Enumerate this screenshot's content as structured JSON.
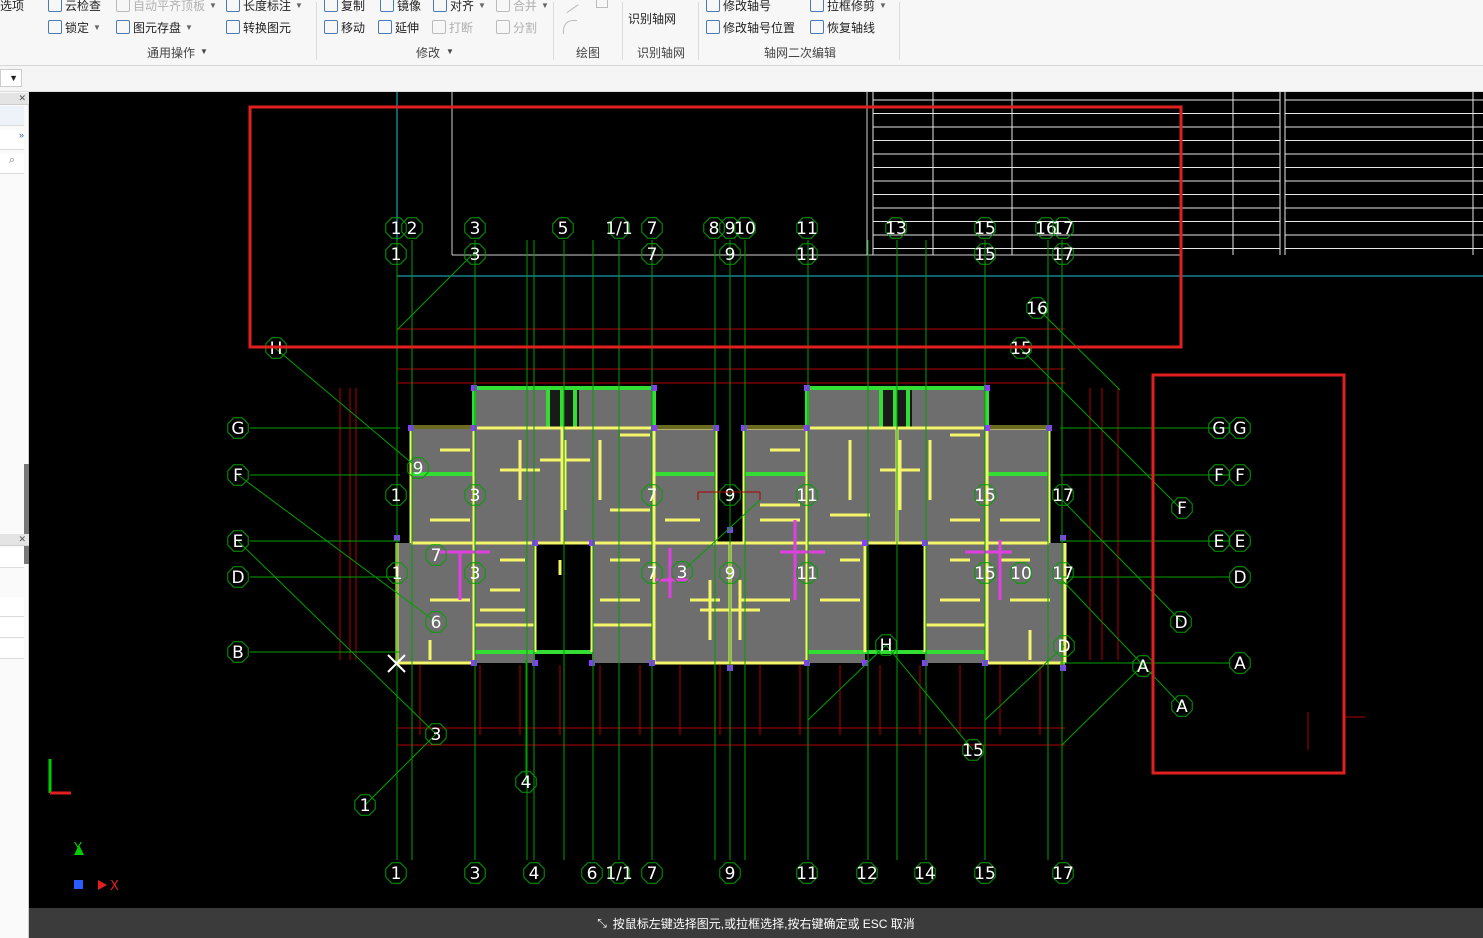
{
  "ribbon": {
    "row1": [
      {
        "name": "options-tab-partial",
        "label": "选项",
        "disabled": false
      },
      {
        "name": "cloud-check-button",
        "label": "云检查",
        "disabled": false
      },
      {
        "name": "auto-flat-board-button",
        "label": "自动平齐顶板",
        "disabled": true
      },
      {
        "name": "length-annotation-button",
        "label": "长度标注",
        "disabled": false
      },
      {
        "name": "copy-button",
        "label": "复制",
        "disabled": false
      },
      {
        "name": "mirror-button",
        "label": "镜像",
        "disabled": false
      },
      {
        "name": "align-button",
        "label": "对齐",
        "disabled": false
      },
      {
        "name": "merge-button",
        "label": "合并",
        "disabled": true
      },
      {
        "name": "modify-axis-number-button",
        "label": "修改轴号",
        "disabled": false
      },
      {
        "name": "box-trim-button",
        "label": "拉框修剪",
        "disabled": false
      }
    ],
    "row2": [
      {
        "name": "lock-button",
        "label": "锁定",
        "disabled": false
      },
      {
        "name": "element-save-button",
        "label": "图元存盘",
        "disabled": false
      },
      {
        "name": "convert-element-button",
        "label": "转换图元",
        "disabled": false
      },
      {
        "name": "move-button",
        "label": "移动",
        "disabled": false
      },
      {
        "name": "extend-button",
        "label": "延伸",
        "disabled": false
      },
      {
        "name": "break-button",
        "label": "打断",
        "disabled": true
      },
      {
        "name": "split-button",
        "label": "分割",
        "disabled": true
      },
      {
        "name": "modify-axis-position-button",
        "label": "修改轴号位置",
        "disabled": false
      },
      {
        "name": "restore-axis-button",
        "label": "恢复轴线",
        "disabled": false
      }
    ],
    "identify_grid_label": "识别轴网",
    "groups": {
      "general": "通用操作",
      "modify": "修改",
      "draw": "绘图",
      "identify": "识别轴网",
      "secondary_edit": "轴网二次编辑"
    }
  },
  "status": {
    "message": "按鼠标左键选择图元,或拉框选择,按右键确定或 ESC 取消"
  },
  "coords": {
    "x_label": "X",
    "y_label": "Y"
  },
  "colors": {
    "canvas_bg": "#000000",
    "axis_green": "#00a000",
    "label_white": "#ffffff",
    "wall_yellow": "#f5f56a",
    "floor_gray": "#6e6e6e",
    "beam_green": "#33dd33",
    "dim_red": "#b00000",
    "highlight_red": "#e02020",
    "magenta": "#e040e0",
    "cyan": "#20c0d0"
  },
  "cad": {
    "axis_labels": [
      {
        "t": "1"
      },
      {
        "t": "2"
      },
      {
        "t": "3"
      },
      {
        "t": "5"
      },
      {
        "t": "1/1"
      },
      {
        "t": "7"
      },
      {
        "t": "8"
      },
      {
        "t": "9"
      },
      {
        "t": "10"
      },
      {
        "t": "11"
      },
      {
        "t": "13"
      },
      {
        "t": "15"
      },
      {
        "t": "16"
      },
      {
        "t": "17"
      },
      {
        "t": "1"
      },
      {
        "t": "3"
      },
      {
        "t": "7"
      },
      {
        "t": "9"
      },
      {
        "t": "11"
      },
      {
        "t": "15"
      },
      {
        "t": "17"
      },
      {
        "t": "16"
      },
      {
        "t": "15"
      },
      {
        "t": "H"
      },
      {
        "t": "G"
      },
      {
        "t": "F"
      },
      {
        "t": "E"
      },
      {
        "t": "D"
      },
      {
        "t": "B"
      },
      {
        "t": "G"
      },
      {
        "t": "G"
      },
      {
        "t": "F"
      },
      {
        "t": "F"
      },
      {
        "t": "F"
      },
      {
        "t": "E"
      },
      {
        "t": "E"
      },
      {
        "t": "D"
      },
      {
        "t": "D"
      },
      {
        "t": "A"
      },
      {
        "t": "A"
      },
      {
        "t": "A"
      },
      {
        "t": "9"
      },
      {
        "t": "1"
      },
      {
        "t": "3"
      },
      {
        "t": "7"
      },
      {
        "t": "9"
      },
      {
        "t": "11"
      },
      {
        "t": "15"
      },
      {
        "t": "17"
      },
      {
        "t": "7"
      },
      {
        "t": "1"
      },
      {
        "t": "3"
      },
      {
        "t": "7"
      },
      {
        "t": "3"
      },
      {
        "t": "9"
      },
      {
        "t": "11"
      },
      {
        "t": "15"
      },
      {
        "t": "10"
      },
      {
        "t": "17"
      },
      {
        "t": "6"
      },
      {
        "t": "H"
      },
      {
        "t": "D"
      },
      {
        "t": "3"
      },
      {
        "t": "15"
      },
      {
        "t": "4"
      },
      {
        "t": "1"
      },
      {
        "t": "1"
      },
      {
        "t": "3"
      },
      {
        "t": "4"
      },
      {
        "t": "6"
      },
      {
        "t": "1/1"
      },
      {
        "t": "7"
      },
      {
        "t": "9"
      },
      {
        "t": "11"
      },
      {
        "t": "12"
      },
      {
        "t": "14"
      },
      {
        "t": "15"
      },
      {
        "t": "17"
      }
    ]
  }
}
